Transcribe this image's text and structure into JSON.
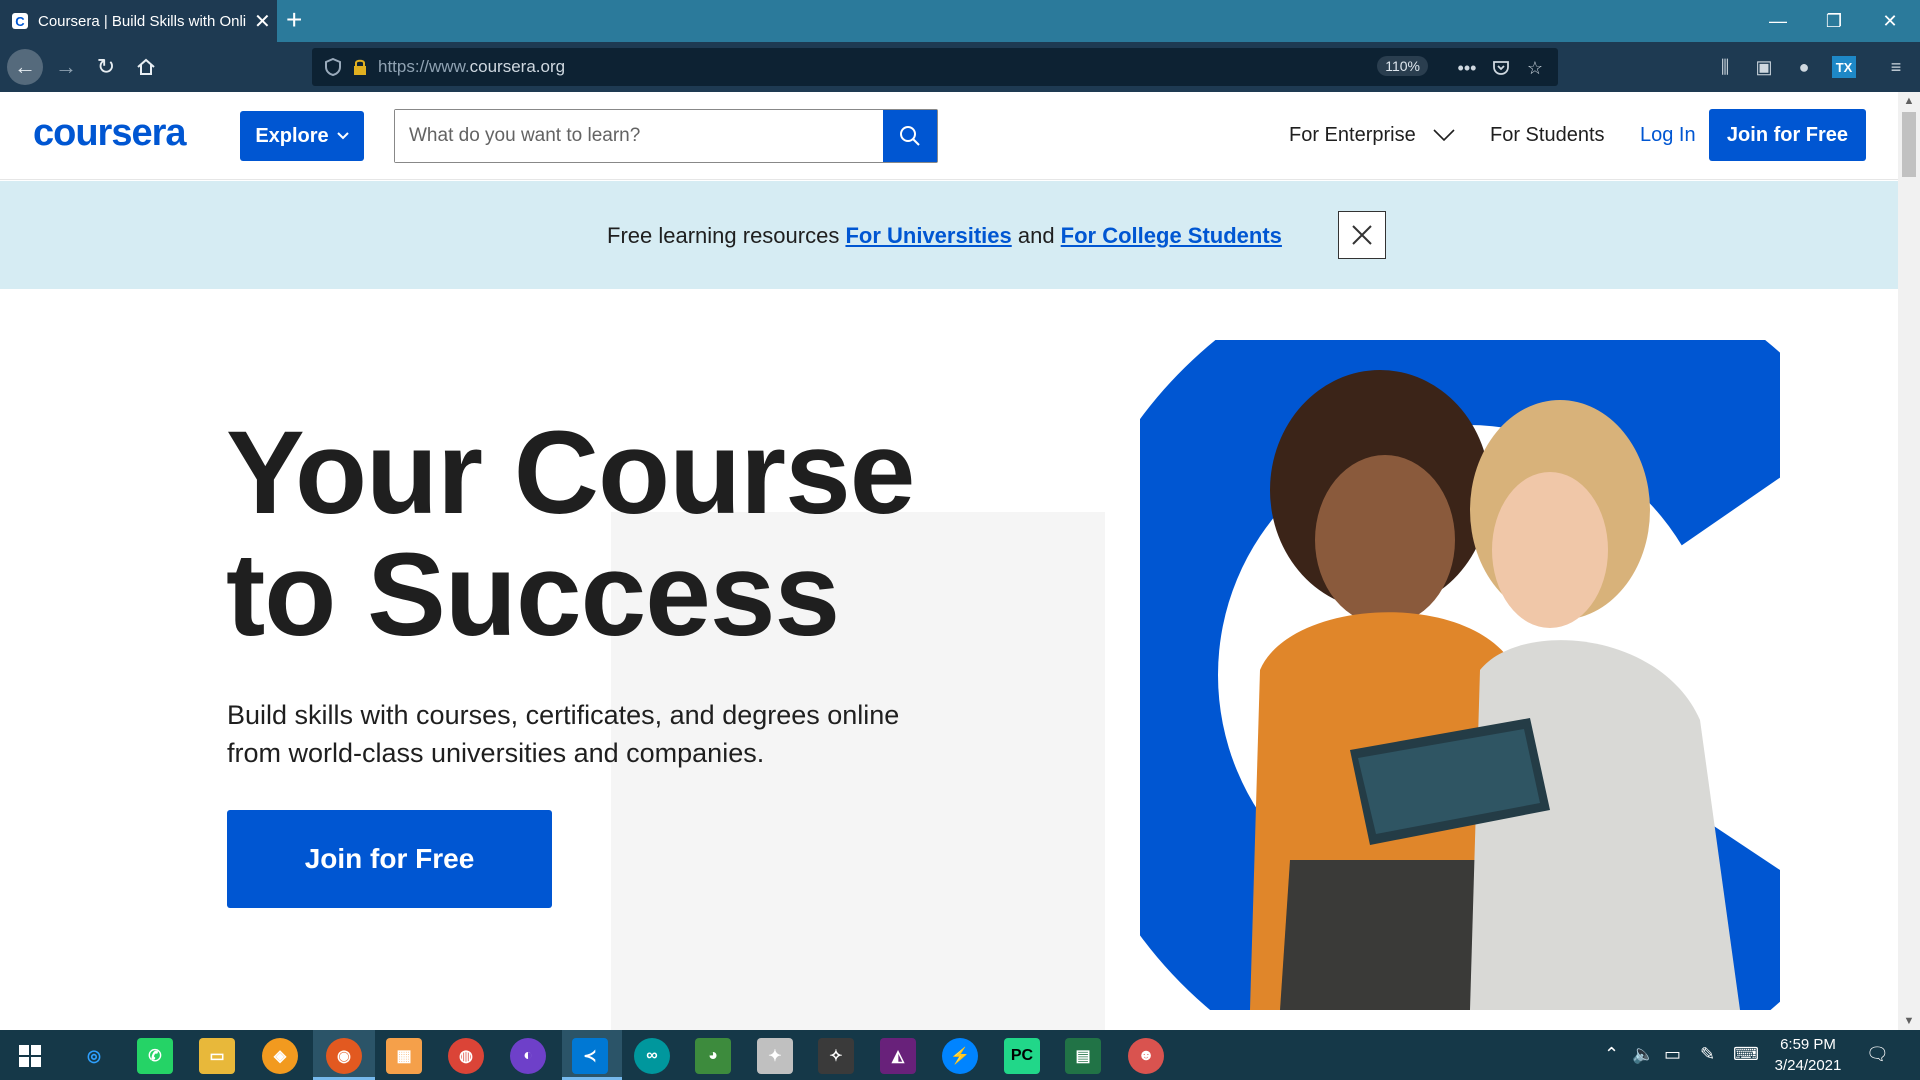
{
  "browser": {
    "tab_title": "Coursera | Build Skills with Online",
    "tab_favicon_letter": "C",
    "url_prefix": "https://www.",
    "url_domain": "coursera.org",
    "zoom": "110%"
  },
  "header": {
    "logo": "coursera",
    "explore_label": "Explore",
    "search_placeholder": "What do you want to learn?",
    "for_enterprise": "For Enterprise",
    "for_students": "For Students",
    "login": "Log In",
    "join": "Join for Free"
  },
  "banner": {
    "prefix": "Free learning resources ",
    "link1": "For Universities",
    "middle": " and ",
    "link2": "For College Students"
  },
  "hero": {
    "title_line1": "Your Course",
    "title_line2": "to Success",
    "subtitle_line1": "Build skills with courses, certificates, and degrees online",
    "subtitle_line2": "from world-class universities and companies.",
    "cta": "Join for Free"
  },
  "taskbar": {
    "time": "6:59 PM",
    "date": "3/24/2021"
  },
  "colors": {
    "brand_blue": "#0056d2",
    "banner_bg": "#d6ecf3",
    "tab_bar": "#2b7a9b"
  }
}
